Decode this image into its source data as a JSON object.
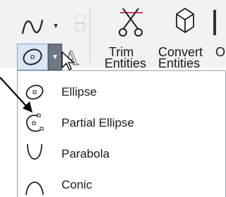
{
  "ribbon": {
    "trim_label": "Trim",
    "trim_sub": "Entities",
    "convert_label": "Convert",
    "convert_sub": "Entities",
    "partial_next": "O"
  },
  "menu": {
    "items": [
      {
        "label": "Ellipse",
        "icon": "ellipse-icon"
      },
      {
        "label": "Partial Ellipse",
        "icon": "partial-ellipse-icon"
      },
      {
        "label": "Parabola",
        "icon": "parabola-icon"
      },
      {
        "label": "Conic",
        "icon": "conic-icon"
      }
    ]
  },
  "colors": {
    "ribbon_bg": "#f1f2f4",
    "highlight": "#dbe6f4",
    "caret_box": "#6d7884",
    "trim_accent": "#d4367a"
  }
}
